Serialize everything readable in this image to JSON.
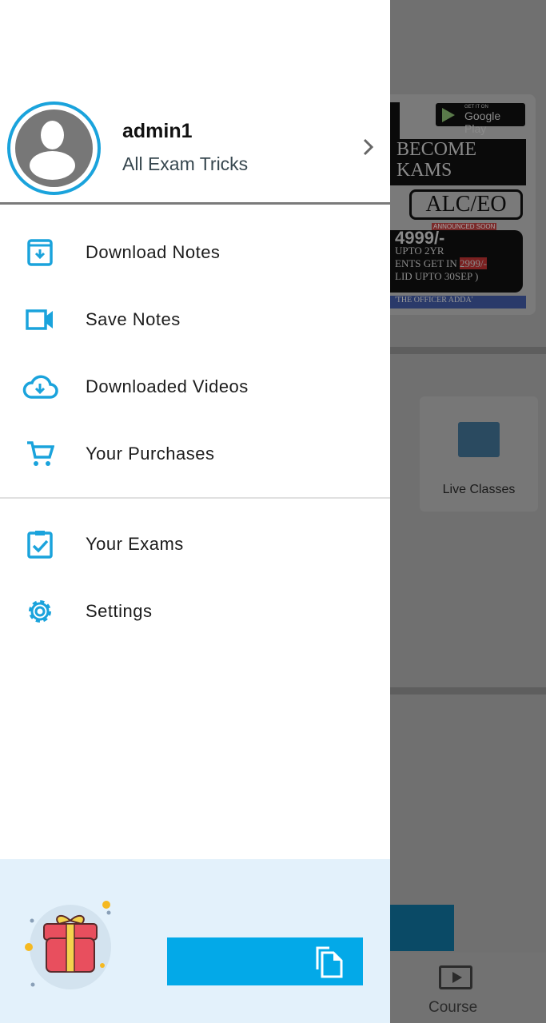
{
  "background": {
    "banner": {
      "store_badge_small": "GET IT ON",
      "store_badge": "Google Play",
      "line1": "BECOME",
      "line2": "KAMS",
      "tag": "ALC/EO",
      "announced": "ANNOUNCED SOON",
      "price": "4999/-",
      "validity": "UPTO 2YR",
      "offer": "ENTS GET IN",
      "offer_price": "2999/-",
      "valid": "LID UPTO 30SEP )",
      "footer": "'THE OFFICER ADDA'"
    },
    "card_label": "Live Classes",
    "bottom_nav_label": "Course"
  },
  "drawer": {
    "user": {
      "name": "admin1",
      "subtitle": "All Exam Tricks"
    },
    "items": [
      {
        "label": "Download Notes",
        "icon": "download-notes-icon"
      },
      {
        "label": "Save Notes",
        "icon": "video-camera-icon"
      },
      {
        "label": "Downloaded Videos",
        "icon": "cloud-download-icon"
      },
      {
        "label": "Your Purchases",
        "icon": "cart-icon"
      }
    ],
    "items2": [
      {
        "label": "Your Exams",
        "icon": "clipboard-check-icon"
      },
      {
        "label": "Settings",
        "icon": "gear-icon"
      }
    ],
    "accent": "#1aa3dc",
    "footer": {
      "icon": "gift-icon",
      "button_icon": "copy-icon",
      "button_color": "#03a9e8"
    }
  }
}
